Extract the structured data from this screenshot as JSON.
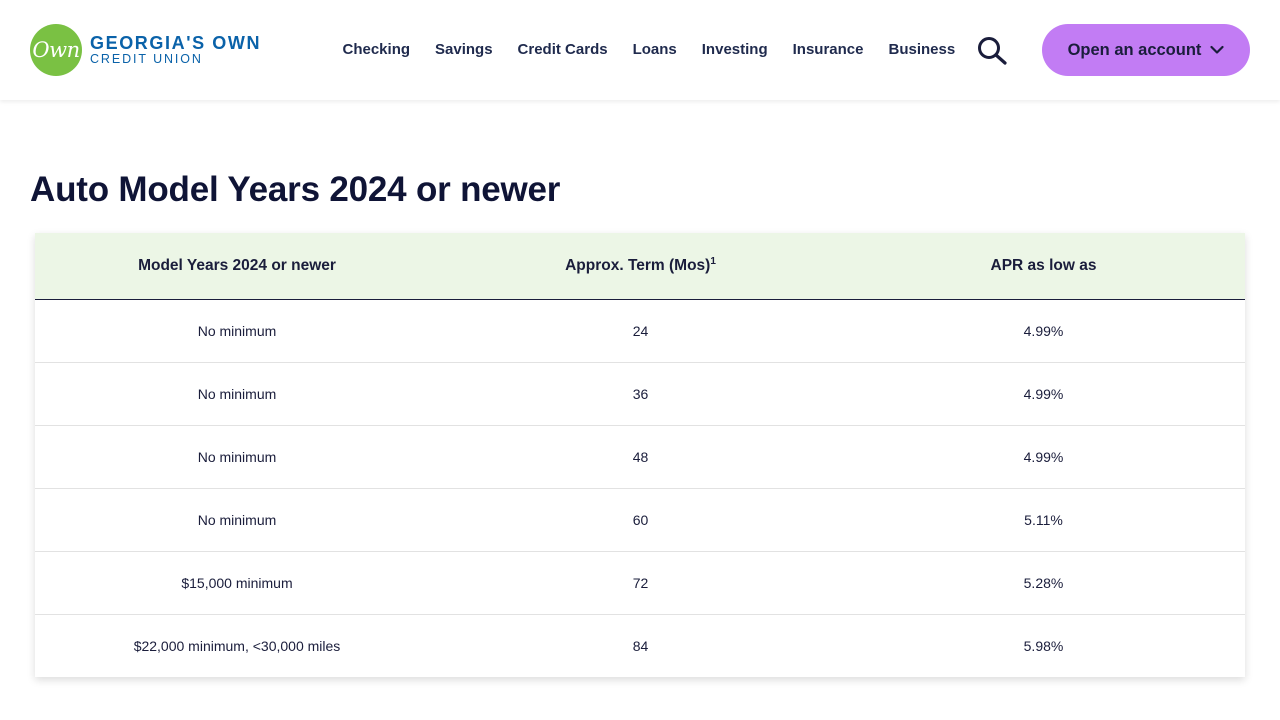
{
  "brand": {
    "badge_text": "Own",
    "name_line1": "GEORGIA'S OWN",
    "name_line2": "CREDIT UNION",
    "badge_color": "#7ac143",
    "text_color": "#0a62a9"
  },
  "nav": {
    "items": [
      {
        "label": "Checking"
      },
      {
        "label": "Savings"
      },
      {
        "label": "Credit Cards"
      },
      {
        "label": "Loans"
      },
      {
        "label": "Investing"
      },
      {
        "label": "Insurance"
      },
      {
        "label": "Business"
      }
    ],
    "search_icon": "search-icon",
    "cta_label": "Open an account",
    "cta_icon": "chevron-down-icon",
    "cta_color": "#c27cf4"
  },
  "page": {
    "title": "Auto Model Years 2024 or newer"
  },
  "rates_table": {
    "header_bg": "#ecf6e6",
    "columns": [
      {
        "label": "Model Years 2024 or newer",
        "footnote": ""
      },
      {
        "label": "Approx. Term (Mos)",
        "footnote": "1"
      },
      {
        "label": "APR as low as",
        "footnote": ""
      }
    ],
    "rows": [
      {
        "model": "No minimum",
        "term": "24",
        "apr": "4.99%"
      },
      {
        "model": "No minimum",
        "term": "36",
        "apr": "4.99%"
      },
      {
        "model": "No minimum",
        "term": "48",
        "apr": "4.99%"
      },
      {
        "model": "No minimum",
        "term": "60",
        "apr": "5.11%"
      },
      {
        "model": "$15,000 minimum",
        "term": "72",
        "apr": "5.28%"
      },
      {
        "model": "$22,000 minimum, <30,000 miles",
        "term": "84",
        "apr": "5.98%"
      }
    ]
  }
}
